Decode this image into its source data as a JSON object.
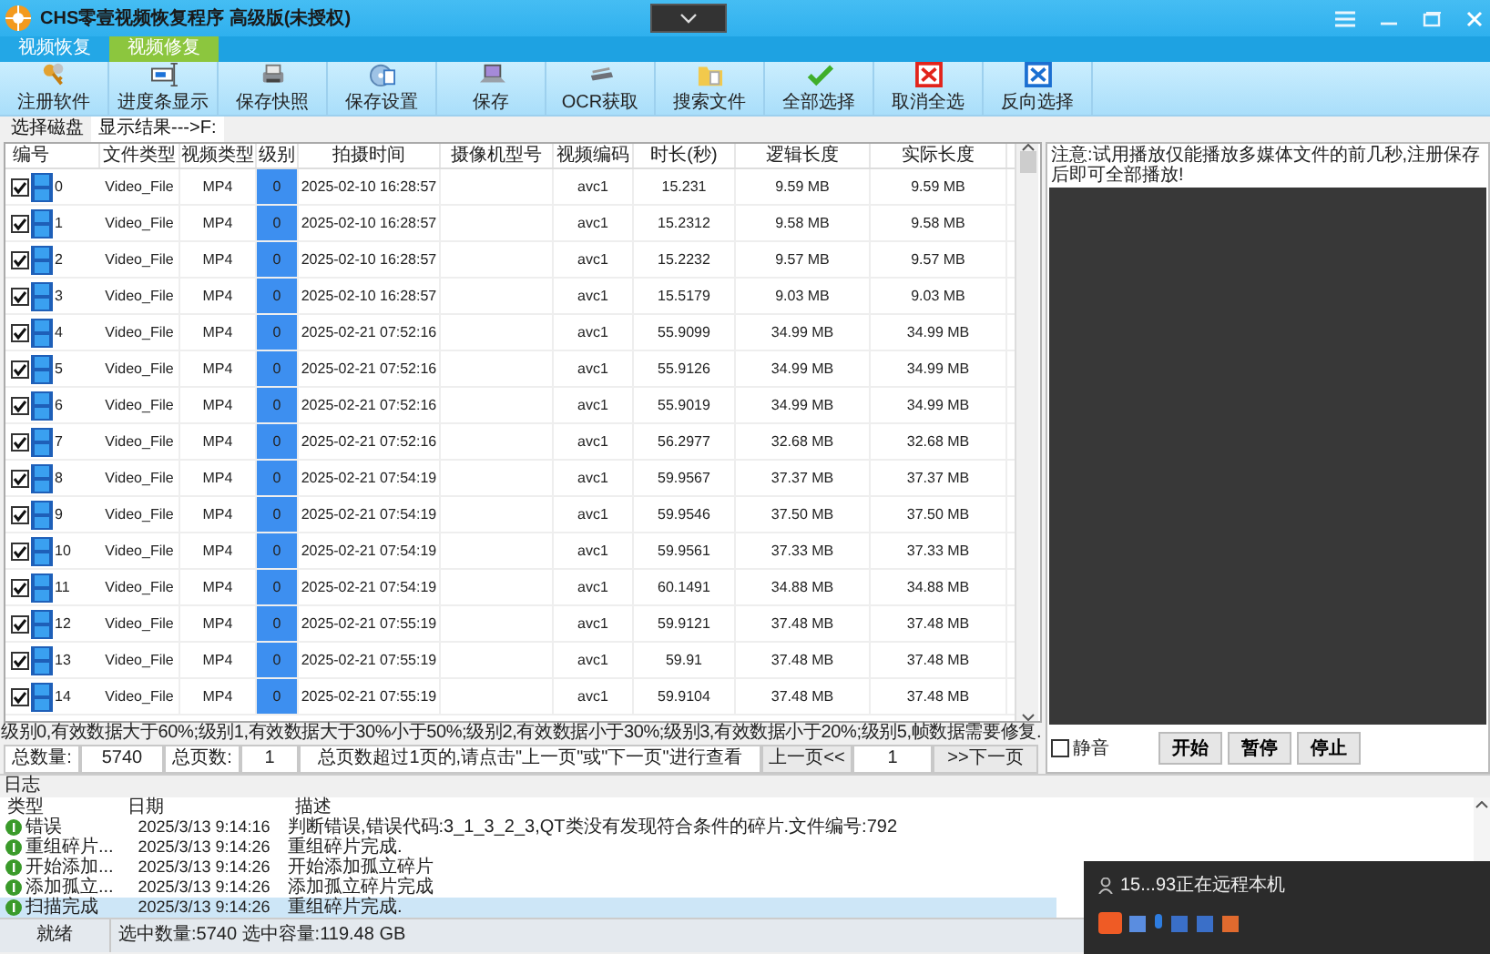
{
  "window": {
    "title": "CHS零壹视频恢复程序 高级版(未授权)"
  },
  "tabs": [
    {
      "label": "视频恢复",
      "selected": false
    },
    {
      "label": "视频修复",
      "selected": true
    }
  ],
  "toolbar": [
    {
      "label": "注册软件"
    },
    {
      "label": "进度条显示"
    },
    {
      "label": "保存快照"
    },
    {
      "label": "保存设置"
    },
    {
      "label": "保存"
    },
    {
      "label": "OCR获取"
    },
    {
      "label": "搜索文件"
    },
    {
      "label": "全部选择"
    },
    {
      "label": "取消全选"
    },
    {
      "label": "反向选择"
    }
  ],
  "subtabs": [
    {
      "label": "选择磁盘",
      "selected": false
    },
    {
      "label": "显示结果--->F:",
      "selected": true
    }
  ],
  "table": {
    "columns": [
      "编号",
      "文件类型",
      "视频类型",
      "级别",
      "拍摄时间",
      "摄像机型号",
      "视频编码",
      "时长(秒)",
      "逻辑长度",
      "实际长度"
    ],
    "rows": [
      {
        "checked": true,
        "number": "0",
        "file_type": "Video_File",
        "video_type": "MP4",
        "grade": "0",
        "time": "2025-02-10 16:28:57",
        "codec": "avc1",
        "duration": "15.231",
        "logical_size": "9.59 MB",
        "actual_size": "9.59 MB"
      },
      {
        "checked": true,
        "number": "1",
        "file_type": "Video_File",
        "video_type": "MP4",
        "grade": "0",
        "time": "2025-02-10 16:28:57",
        "codec": "avc1",
        "duration": "15.2312",
        "logical_size": "9.58 MB",
        "actual_size": "9.58 MB"
      },
      {
        "checked": true,
        "number": "2",
        "file_type": "Video_File",
        "video_type": "MP4",
        "grade": "0",
        "time": "2025-02-10 16:28:57",
        "codec": "avc1",
        "duration": "15.2232",
        "logical_size": "9.57 MB",
        "actual_size": "9.57 MB"
      },
      {
        "checked": true,
        "number": "3",
        "file_type": "Video_File",
        "video_type": "MP4",
        "grade": "0",
        "time": "2025-02-10 16:28:57",
        "codec": "avc1",
        "duration": "15.5179",
        "logical_size": "9.03 MB",
        "actual_size": "9.03 MB"
      },
      {
        "checked": true,
        "number": "4",
        "file_type": "Video_File",
        "video_type": "MP4",
        "grade": "0",
        "time": "2025-02-21 07:52:16",
        "codec": "avc1",
        "duration": "55.9099",
        "logical_size": "34.99 MB",
        "actual_size": "34.99 MB"
      },
      {
        "checked": true,
        "number": "5",
        "file_type": "Video_File",
        "video_type": "MP4",
        "grade": "0",
        "time": "2025-02-21 07:52:16",
        "codec": "avc1",
        "duration": "55.9126",
        "logical_size": "34.99 MB",
        "actual_size": "34.99 MB"
      },
      {
        "checked": true,
        "number": "6",
        "file_type": "Video_File",
        "video_type": "MP4",
        "grade": "0",
        "time": "2025-02-21 07:52:16",
        "codec": "avc1",
        "duration": "55.9019",
        "logical_size": "34.99 MB",
        "actual_size": "34.99 MB"
      },
      {
        "checked": true,
        "number": "7",
        "file_type": "Video_File",
        "video_type": "MP4",
        "grade": "0",
        "time": "2025-02-21 07:52:16",
        "codec": "avc1",
        "duration": "56.2977",
        "logical_size": "32.68 MB",
        "actual_size": "32.68 MB"
      },
      {
        "checked": true,
        "number": "8",
        "file_type": "Video_File",
        "video_type": "MP4",
        "grade": "0",
        "time": "2025-02-21 07:54:19",
        "codec": "avc1",
        "duration": "59.9567",
        "logical_size": "37.37 MB",
        "actual_size": "37.37 MB"
      },
      {
        "checked": true,
        "number": "9",
        "file_type": "Video_File",
        "video_type": "MP4",
        "grade": "0",
        "time": "2025-02-21 07:54:19",
        "codec": "avc1",
        "duration": "59.9546",
        "logical_size": "37.50 MB",
        "actual_size": "37.50 MB"
      },
      {
        "checked": true,
        "number": "10",
        "file_type": "Video_File",
        "video_type": "MP4",
        "grade": "0",
        "time": "2025-02-21 07:54:19",
        "codec": "avc1",
        "duration": "59.9561",
        "logical_size": "37.33 MB",
        "actual_size": "37.33 MB"
      },
      {
        "checked": true,
        "number": "11",
        "file_type": "Video_File",
        "video_type": "MP4",
        "grade": "0",
        "time": "2025-02-21 07:54:19",
        "codec": "avc1",
        "duration": "60.1491",
        "logical_size": "34.88 MB",
        "actual_size": "34.88 MB"
      },
      {
        "checked": true,
        "number": "12",
        "file_type": "Video_File",
        "video_type": "MP4",
        "grade": "0",
        "time": "2025-02-21 07:55:19",
        "codec": "avc1",
        "duration": "59.9121",
        "logical_size": "37.48 MB",
        "actual_size": "37.48 MB"
      },
      {
        "checked": true,
        "number": "13",
        "file_type": "Video_File",
        "video_type": "MP4",
        "grade": "0",
        "time": "2025-02-21 07:55:19",
        "codec": "avc1",
        "duration": "59.91",
        "logical_size": "37.48 MB",
        "actual_size": "37.48 MB"
      },
      {
        "checked": true,
        "number": "14",
        "file_type": "Video_File",
        "video_type": "MP4",
        "grade": "0",
        "time": "2025-02-21 07:55:19",
        "codec": "avc1",
        "duration": "59.9104",
        "logical_size": "37.48 MB",
        "actual_size": "37.48 MB"
      }
    ]
  },
  "legend": "级别0,有效数据大于60%;级别1,有效数据大于30%小于50%;级别2,有效数据小于30%;级别3,有效数据小于20%;级别5,帧数据需要修复.",
  "pager": {
    "total_label": "总数量:",
    "total": "5740",
    "pages_label": "总页数:",
    "pages": "1",
    "hint": "总页数超过1页的,请点击\"上一页\"或\"下一页\"进行查看",
    "prev": "上一页<<",
    "page": "1",
    "next": ">>下一页"
  },
  "player": {
    "notice": "注意:试用播放仅能播放多媒体文件的前几秒,注册保存后即可全部播放!",
    "mute": {
      "label": "静音",
      "checked": false
    },
    "buttons": [
      "开始",
      "暂停",
      "停止"
    ]
  },
  "log": {
    "title": "日志",
    "columns": [
      "类型",
      "日期",
      "描述"
    ],
    "rows": [
      {
        "type": "错误",
        "date": "2025/3/13 9:14:16",
        "description": "判断错误,错误代码:3_1_3_2_3,QT类没有发现符合条件的碎片.文件编号:792",
        "selected": false
      },
      {
        "type": "重组碎片...",
        "date": "2025/3/13 9:14:26",
        "description": "重组碎片完成.",
        "selected": false
      },
      {
        "type": "开始添加...",
        "date": "2025/3/13 9:14:26",
        "description": "开始添加孤立碎片",
        "selected": false
      },
      {
        "type": "添加孤立...",
        "date": "2025/3/13 9:14:26",
        "description": "添加孤立碎片完成",
        "selected": false
      },
      {
        "type": "扫描完成",
        "date": "2025/3/13 9:14:26",
        "description": "重组碎片完成.",
        "selected": true
      }
    ]
  },
  "status_bar": [
    "就绪",
    "选中数量:5740 选中容量:119.48 GB"
  ],
  "remote_popup": {
    "text": "15...93正在远程本机"
  }
}
